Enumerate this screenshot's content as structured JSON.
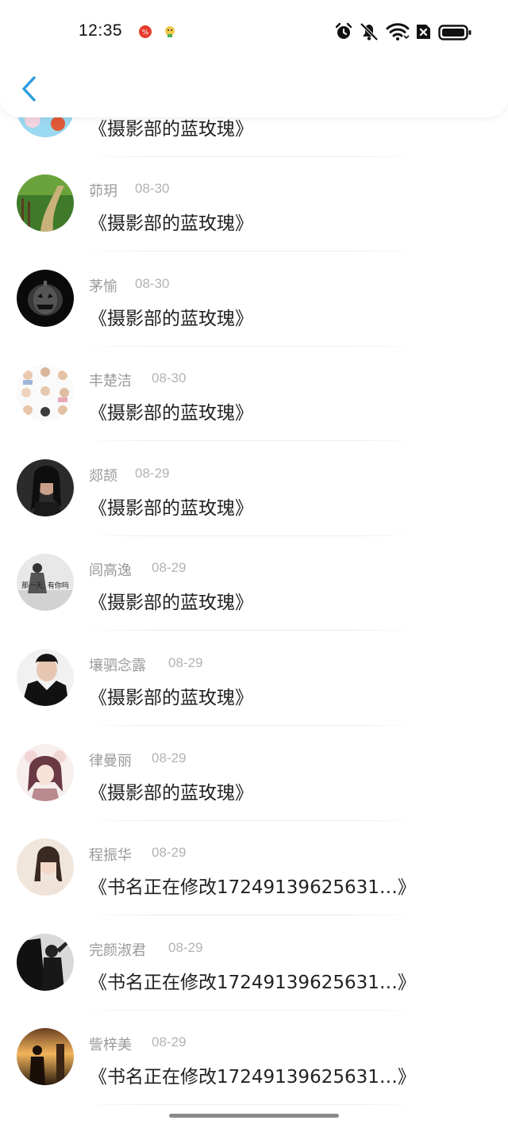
{
  "status_bar": {
    "time": "12:35",
    "icons": [
      "notification-app-icon-1",
      "notification-app-icon-2",
      "alarm-icon",
      "mute-icon",
      "wifi-icon",
      "no-sim-icon",
      "battery-icon"
    ]
  },
  "header": {
    "back_icon": "chevron-left-icon",
    "accent": "#2c9be0"
  },
  "items": [
    {
      "name": "",
      "date": "",
      "title": "《摄影部的蓝玫瑰》",
      "avatar": "partial-top"
    },
    {
      "name": "茆玥",
      "date": "08-30",
      "title": "《摄影部的蓝玫瑰》",
      "avatar": "green-path"
    },
    {
      "name": "茅愉",
      "date": "08-30",
      "title": "《摄影部的蓝玫瑰》",
      "avatar": "dark-pumpkin"
    },
    {
      "name": "丰楚洁",
      "date": "08-30",
      "title": "《摄影部的蓝玫瑰》",
      "avatar": "cartoon-grid"
    },
    {
      "name": "郯颉",
      "date": "08-29",
      "title": "《摄影部的蓝玫瑰》",
      "avatar": "girl-dark"
    },
    {
      "name": "闾高逸",
      "date": "08-29",
      "title": "《摄影部的蓝玫瑰》",
      "avatar": "text-photo",
      "avatar_text": "那一天, 有你吗"
    },
    {
      "name": "壤驷念露",
      "date": "08-29",
      "title": "《摄影部的蓝玫瑰》",
      "avatar": "boy-hoodie"
    },
    {
      "name": "律曼丽",
      "date": "08-29",
      "title": "《摄影部的蓝玫瑰》",
      "avatar": "anime-girl"
    },
    {
      "name": "程振华",
      "date": "08-29",
      "title": "《书名正在修改17249139625631…》",
      "avatar": "girl-light"
    },
    {
      "name": "完颜淑君",
      "date": "08-29",
      "title": "《书名正在修改17249139625631…》",
      "avatar": "bw-figure"
    },
    {
      "name": "訾梓美",
      "date": "08-29",
      "title": "《书名正在修改17249139625631…》",
      "avatar": "sunset-silhouette"
    }
  ]
}
